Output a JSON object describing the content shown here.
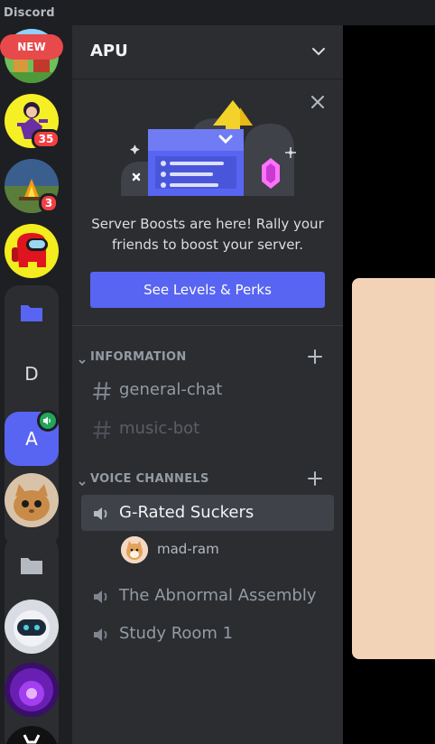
{
  "app": {
    "title": "Discord"
  },
  "server_rail": {
    "new_label": "NEW",
    "badges": {
      "server2": "35",
      "server3": "3"
    },
    "letter_servers": {
      "d": "D",
      "a": "A"
    },
    "icons": [
      "guild-avatar",
      "folder-icon",
      "speaker-icon"
    ]
  },
  "server": {
    "name": "APU"
  },
  "boost": {
    "text": "Server Boosts are here! Rally your friends to boost your server.",
    "button_label": "See Levels & Perks"
  },
  "categories": [
    {
      "label": "INFORMATION",
      "channels": [
        {
          "name": "general-chat",
          "type": "text"
        },
        {
          "name": "music-bot",
          "type": "text",
          "muted": true
        }
      ]
    },
    {
      "label": "VOICE CHANNELS",
      "channels": [
        {
          "name": "G-Rated Suckers",
          "type": "voice",
          "active": true,
          "users": [
            {
              "name": "mad-ram"
            }
          ]
        },
        {
          "name": "The Abnormal Assembly",
          "type": "voice"
        },
        {
          "name": "Study Room 1",
          "type": "voice"
        }
      ]
    }
  ],
  "colors": {
    "brand": "#5865f2",
    "alert": "#f23f43",
    "voice_connected": "#23a55a",
    "panel": "#2b2d31",
    "rail": "#1e1f22"
  }
}
